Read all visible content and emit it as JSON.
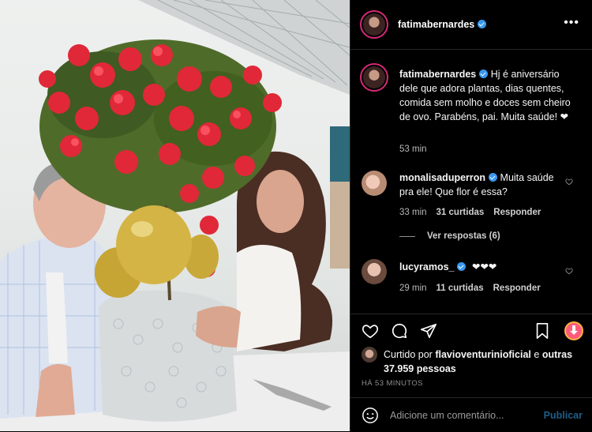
{
  "post": {
    "author": "fatimabernardes",
    "caption": "Hj é aniversário dele que adora plantas, dias quentes, comida sem molho e doces sem cheiro de ovo. Parabéns, pai. Muita saúde! ❤",
    "caption_time": "53 min"
  },
  "comments": [
    {
      "user": "monalisaduperron",
      "text": "Muita saúde pra ele! Que flor é essa?",
      "time": "33 min",
      "likes": "31 curtidas",
      "reply": "Responder",
      "view_replies": "Ver respostas (6)"
    },
    {
      "user": "lucyramos_",
      "text": "❤❤❤",
      "time": "29 min",
      "likes": "11 curtidas",
      "reply": "Responder"
    }
  ],
  "likes": {
    "prefix": "Curtido por",
    "user": "flavioventurinioficial",
    "conj": "e",
    "others": "outras 37.959 pessoas"
  },
  "timestamp": "HÁ 53 MINUTOS",
  "composer": {
    "placeholder": "Adicione um comentário...",
    "publish": "Publicar"
  },
  "colors": {
    "verified": "#3897f0",
    "ring": "#d62976",
    "publish_disabled": "#1f5e8a"
  }
}
